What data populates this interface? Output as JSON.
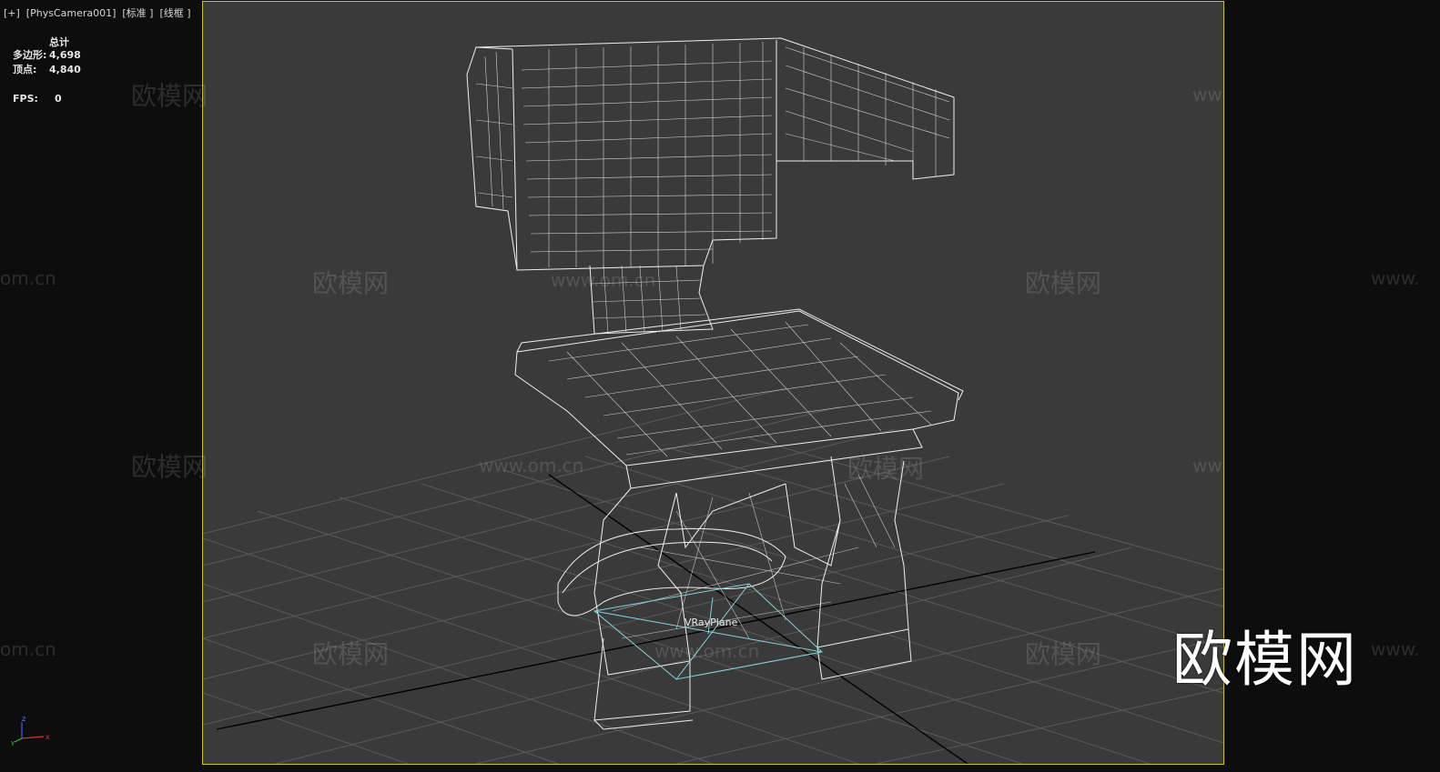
{
  "viewport": {
    "label": "[+]  [PhysCamera001]  [标准 ]  [线框 ]",
    "frame_color": "#c9c21f",
    "background": "#3a3a3a"
  },
  "stats": {
    "header": "总计",
    "polygons_label": "多边形:",
    "polygons_value": "4,698",
    "vertices_label": "顶点:",
    "vertices_value": "4,840",
    "fps_label": "FPS:",
    "fps_value": "0"
  },
  "scene": {
    "object_label": "VRayPlane",
    "wireframe_color": "#ffffff",
    "helper_color": "#7fd6e0"
  },
  "watermarks": {
    "cn": "欧模网",
    "url": "www.om.cn",
    "url_short": "om.cn",
    "url_cut": "www.",
    "brand": "欧模网"
  },
  "gizmo": {
    "x": "x",
    "y": "y",
    "z": "z"
  }
}
